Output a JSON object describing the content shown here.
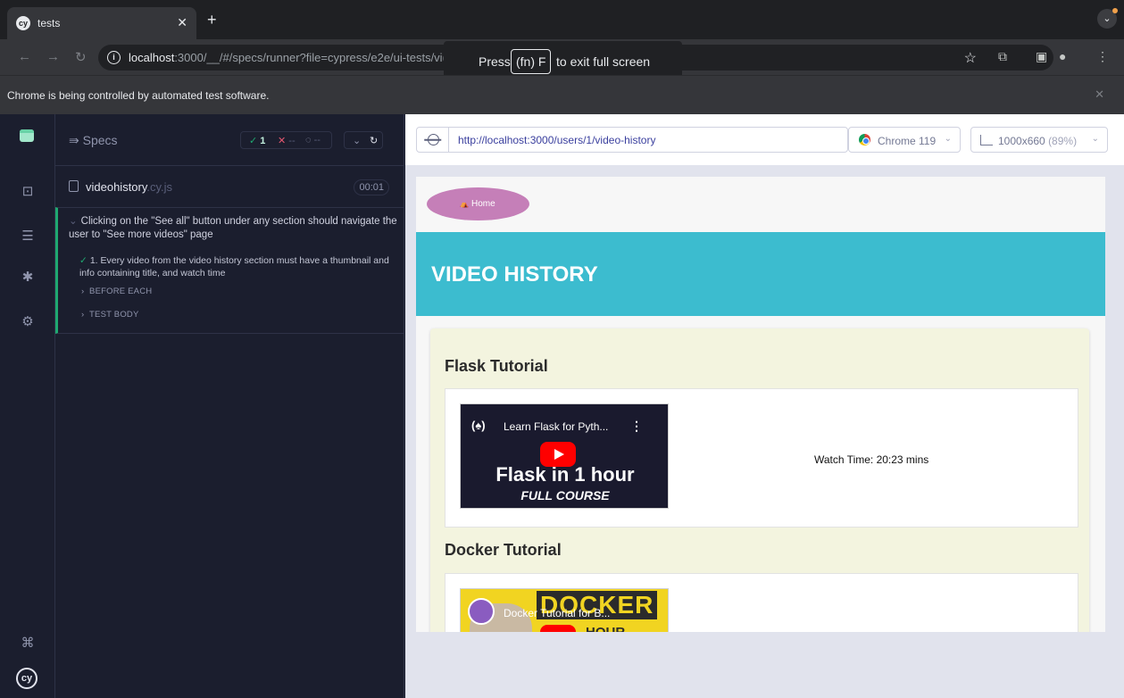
{
  "browser": {
    "tab_title": "tests",
    "tab_icon": "cy",
    "url_host": "localhost",
    "url_rest": ":3000/__/#/specs/runner?file=cypress/e2e/ui-tests/vi",
    "url_fade": "deohi",
    "fullscreen_toast": {
      "before": "Press",
      "key": "(fn) F",
      "after": "to exit full screen"
    },
    "infobar_message": "Chrome is being controlled by automated test software."
  },
  "specs_panel": {
    "label": "Specs",
    "stats": {
      "passed": "1",
      "failed": "--",
      "pending": "--"
    },
    "spec_file": {
      "name": "videohistory",
      "ext": ".cy.js",
      "duration": "00:01"
    },
    "suite_title": "Clicking on the \"See all\" button under any section should navigate the user to \"See more videos\" page",
    "test_title": "1. Every video from the video history section must have a thumbnail and info containing title, and watch time",
    "hooks": [
      "BEFORE EACH",
      "TEST BODY"
    ]
  },
  "runner": {
    "aut_url": "http://localhost:3000/users/1/video-history",
    "browser_label": "Chrome 119",
    "viewport_label": "1000x660",
    "viewport_scale": "(89%)"
  },
  "app": {
    "home_label": "Home",
    "page_heading": "VIDEO HISTORY",
    "sections": [
      {
        "title": "Flask Tutorial",
        "video_title": "Learn Flask for Pyth...",
        "thumb_line1": "Flask in 1 hour",
        "thumb_line2": "FULL COURSE",
        "watch_time": "Watch Time: 20:23 mins"
      },
      {
        "title": "Docker Tutorial",
        "video_title": "Docker Tutorial for B...",
        "thumb_banner": "DOCKER",
        "thumb_line1": "HOUR"
      }
    ]
  },
  "colors": {
    "pass": "#1fa971",
    "fail": "#e45770",
    "banner": "#3cbccf",
    "home_button": "#c57fb8",
    "content_bg": "#f3f4df"
  }
}
